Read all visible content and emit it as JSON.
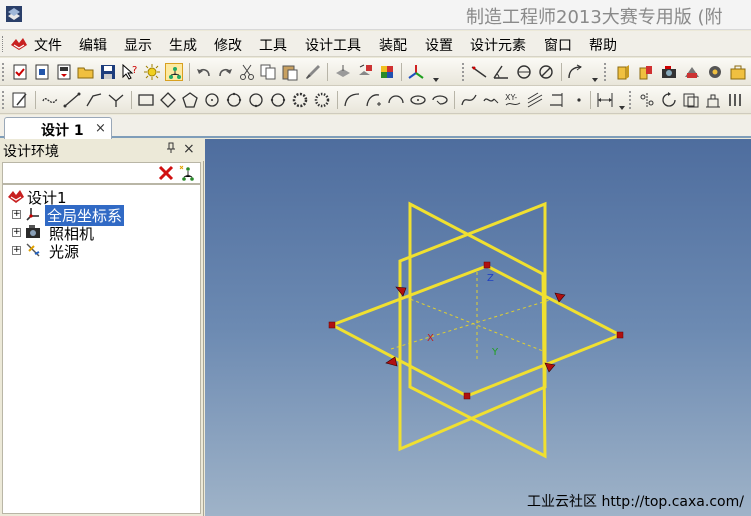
{
  "title": "制造工程师2013大赛专用版（附",
  "title_display": "制造工程师2013大赛专用版 (附",
  "menu": {
    "items": [
      "文件",
      "编辑",
      "显示",
      "生成",
      "修改",
      "工具",
      "设计工具",
      "装配",
      "设置",
      "设计元素",
      "窗口",
      "帮助"
    ]
  },
  "toolbar_icons": {
    "row1": [
      "new-file-icon",
      "open-file-icon",
      "template-icon",
      "folder-icon",
      "save-icon",
      "help-pointer-icon",
      "sun-icon",
      "design-tree-icon",
      "undo-icon",
      "redo-icon",
      "cut-icon",
      "copy-icon",
      "paste-icon",
      "brush-icon",
      "render-icon",
      "snap-icon",
      "material-icon",
      "axis-icon",
      "angle-line-icon",
      "angle-icon",
      "circle-icon",
      "no-entry-icon",
      "arc-dimension-icon",
      "part-icon",
      "assembly-icon",
      "camera-icon",
      "light-icon",
      "gear-icon",
      "toolbox-icon"
    ],
    "row2": [
      "sketch-icon",
      "curve-icon",
      "line-icon",
      "polyline-icon",
      "branch-icon",
      "rectangle-icon",
      "polygon-icon",
      "pentagon-icon",
      "circle-center-icon",
      "circle-3pt-icon",
      "circle-tan-icon",
      "circle-alt-icon",
      "gear-circle-icon",
      "circle-gear-icon",
      "arc-icon",
      "arc-tangent-icon",
      "arc-3pt-icon",
      "ellipse-icon",
      "ellipse-arc-icon",
      "spline-icon",
      "offset-icon",
      "text-icon",
      "hatch-icon",
      "trim-icon",
      "point-icon",
      "dimension-icon",
      "mirror-icon",
      "rotate-icon",
      "copy-shape-icon",
      "extrude-icon",
      "revolve-icon"
    ]
  },
  "document_tab": {
    "label": "设计 1",
    "close": "×"
  },
  "left_panel": {
    "title": "设计环境",
    "pin": "ᵖ",
    "close": "×"
  },
  "tree": {
    "root": "设计1",
    "children": [
      "全局坐标系",
      "照相机",
      "光源"
    ],
    "selected": "全局坐标系",
    "expander": "+"
  },
  "viewport": {
    "axis_labels": {
      "x": "X",
      "y": "Y",
      "z": "Z"
    },
    "plane_color": "#f0e030",
    "handle_color": "#b01010",
    "background_top": "#4e6d9e",
    "background_bottom": "#9fb3c8"
  },
  "watermark": "工业云社区 http://top.caxa.com/"
}
